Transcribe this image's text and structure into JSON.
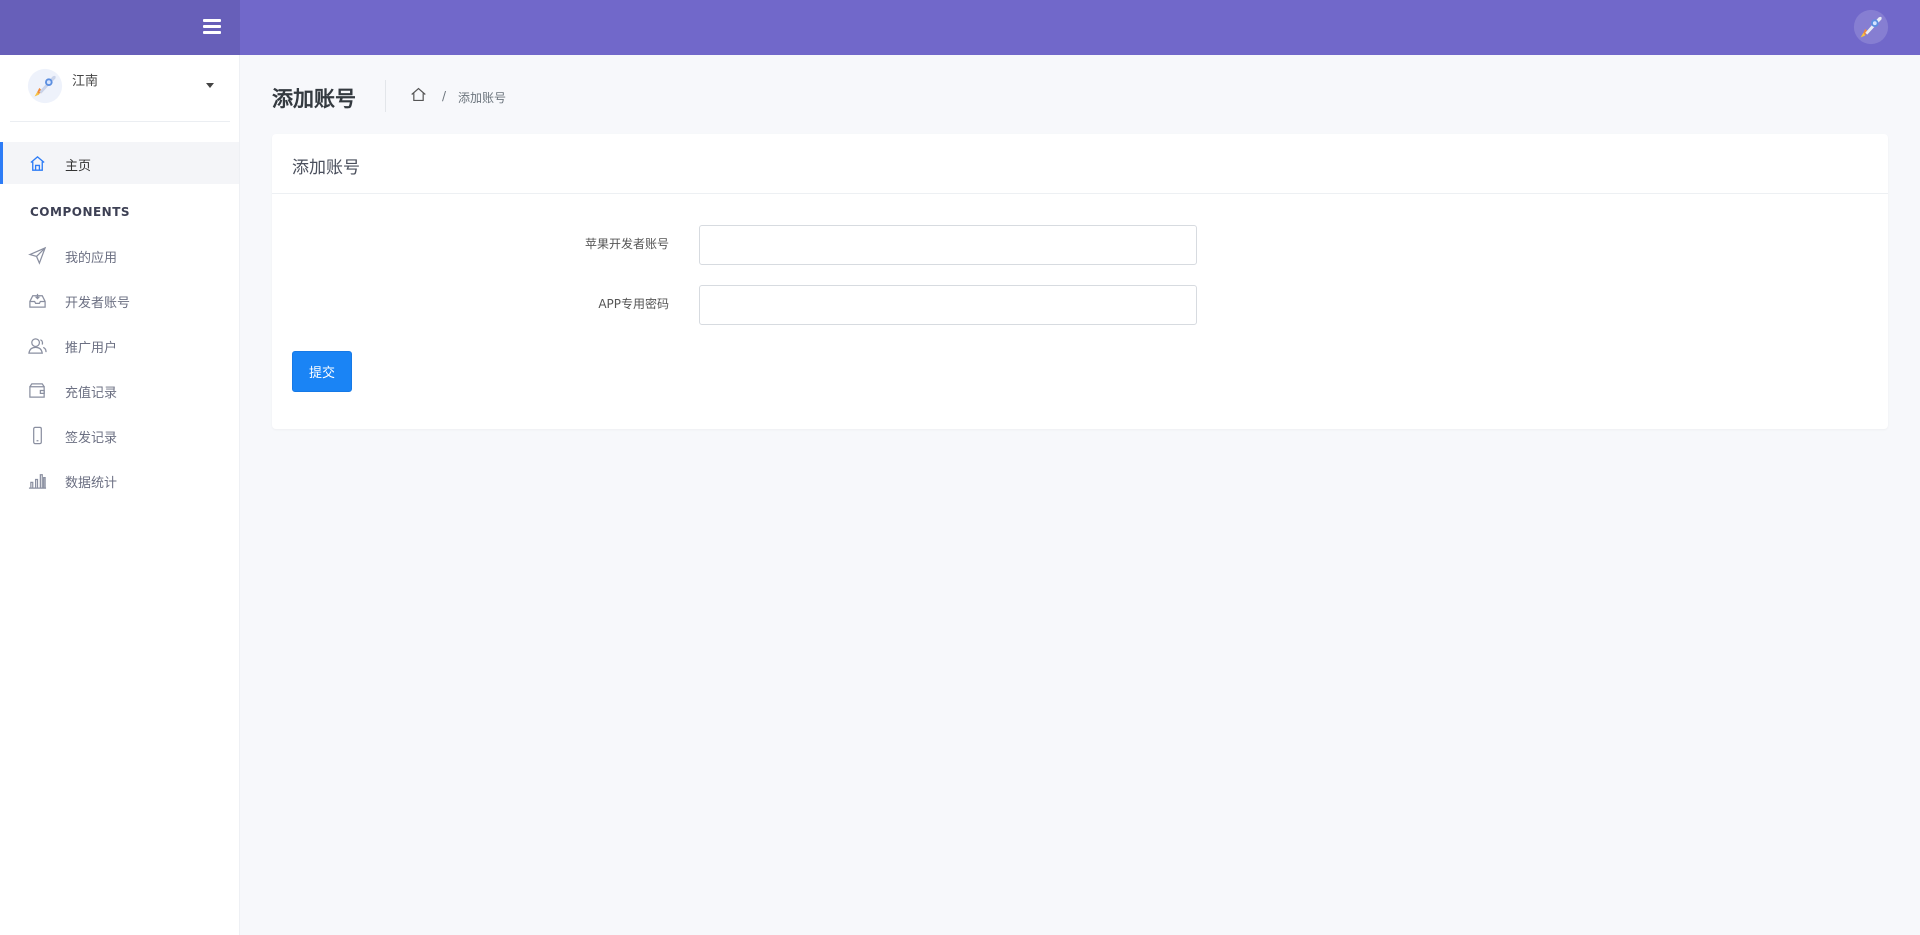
{
  "user": {
    "name": "江南"
  },
  "sidebar": {
    "home_label": "主页",
    "section_title": "COMPONENTS",
    "items": [
      {
        "label": "我的应用",
        "icon": "send-icon"
      },
      {
        "label": "开发者账号",
        "icon": "inbox-icon"
      },
      {
        "label": "推广用户",
        "icon": "users-icon"
      },
      {
        "label": "充值记录",
        "icon": "wallet-icon"
      },
      {
        "label": "签发记录",
        "icon": "phone-icon"
      },
      {
        "label": "数据统计",
        "icon": "bar-chart-icon"
      }
    ]
  },
  "page": {
    "title": "添加账号",
    "breadcrumb_sep": "/",
    "breadcrumb_current": "添加账号"
  },
  "card": {
    "title": "添加账号",
    "fields": [
      {
        "label": "苹果开发者账号",
        "value": ""
      },
      {
        "label": "APP专用密码",
        "value": ""
      }
    ],
    "submit_label": "提交"
  },
  "colors": {
    "topbar": "#7168ca",
    "brand": "#675fb9",
    "accent": "#1a84f5",
    "active_indicator": "#2d7cf6"
  }
}
